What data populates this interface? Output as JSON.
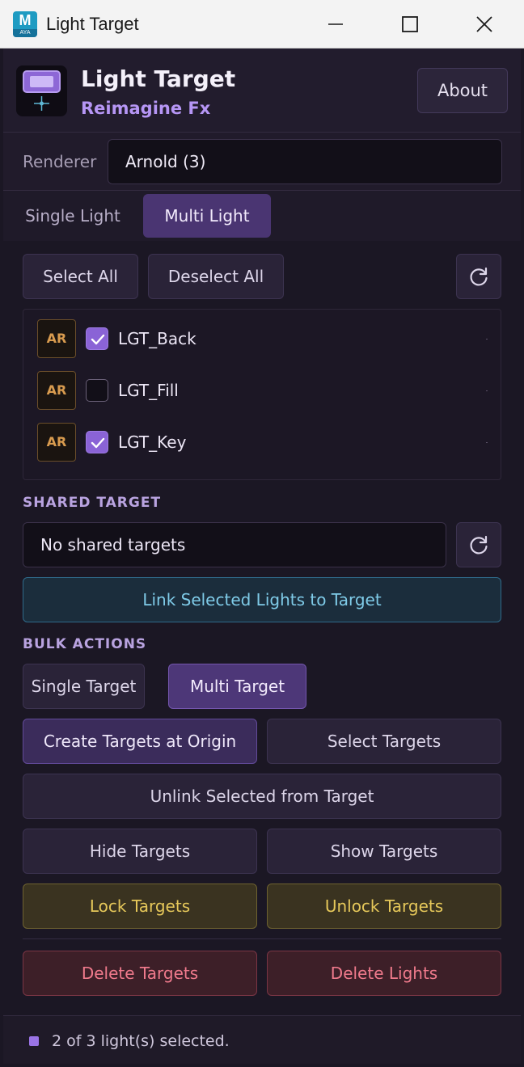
{
  "window": {
    "title": "Light Target",
    "app_icon_letter": "M",
    "app_icon_subtext": "AYA"
  },
  "header": {
    "app_name": "Light Target",
    "subtitle": "Reimagine Fx",
    "about_label": "About"
  },
  "renderer": {
    "label": "Renderer",
    "selected": "Arnold  (3)"
  },
  "tabs": [
    {
      "label": "Single Light",
      "active": false
    },
    {
      "label": "Multi Light",
      "active": true
    }
  ],
  "light_selection": {
    "select_all_label": "Select All",
    "deselect_all_label": "Deselect All",
    "refresh_icon": "refresh-icon"
  },
  "lights": [
    {
      "badge": "AR",
      "name": "LGT_Back",
      "checked": true
    },
    {
      "badge": "AR",
      "name": "LGT_Fill",
      "checked": false
    },
    {
      "badge": "AR",
      "name": "LGT_Key",
      "checked": true
    }
  ],
  "shared_target": {
    "section_label": "SHARED TARGET",
    "value": "No shared targets",
    "link_button_label": "Link Selected Lights to Target"
  },
  "bulk_actions": {
    "section_label": "BULK ACTIONS",
    "mode_tabs": [
      {
        "label": "Single Target",
        "active": false
      },
      {
        "label": "Multi Target",
        "active": true
      }
    ],
    "create_targets": "Create Targets at Origin",
    "select_targets": "Select Targets",
    "unlink_selected": "Unlink Selected from Target",
    "hide_targets": "Hide Targets",
    "show_targets": "Show Targets",
    "lock_targets": "Lock Targets",
    "unlock_targets": "Unlock Targets",
    "delete_targets": "Delete Targets",
    "delete_lights": "Delete Lights"
  },
  "status": {
    "text": "2 of 3 light(s) selected."
  },
  "colors": {
    "accent_purple": "#8a63d6",
    "link_blue": "#7fcbe8",
    "lock_yellow": "#e6c85a",
    "delete_red": "#f07a8c",
    "badge_orange": "#d89b4f"
  }
}
